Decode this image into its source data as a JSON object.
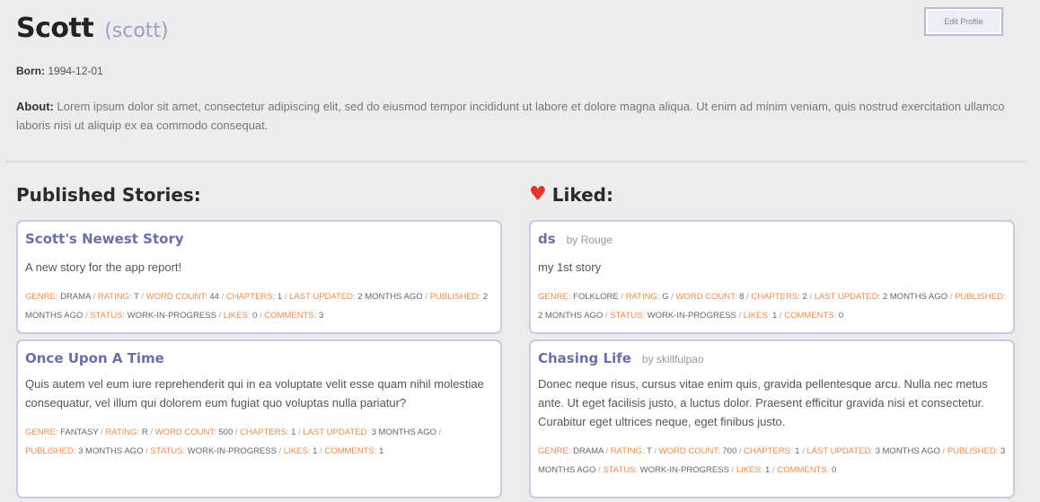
{
  "profile": {
    "name": "Scott",
    "username": "(scott)",
    "edit_button": "Edit Profile",
    "born_label": "Born:",
    "born_value": "1994-12-01",
    "about_label": "About:",
    "about_text": "Lorem ipsum dolor sit amet, consectetur adipiscing elit, sed do eiusmod tempor incididunt ut labore et dolore magna aliqua. Ut enim ad minim veniam, quis nostrud exercitation ullamco laboris nisi ut aliquip ex ea commodo consequat."
  },
  "published": {
    "title": "Published Stories:",
    "stories": [
      {
        "title": "Scott's Newest Story",
        "description": "A new story for the app report!",
        "genre": "DRAMA",
        "rating": "T",
        "word_count": "44",
        "chapters": "1",
        "last_updated": "2 MONTHS AGO",
        "published": "2 MONTHS AGO",
        "status": "WORK-IN-PROGRESS",
        "likes": "0",
        "comments": "3"
      },
      {
        "title": "Once Upon A Time",
        "description": "Quis autem vel eum iure reprehenderit qui in ea voluptate velit esse quam nihil molestiae consequatur, vel illum qui dolorem eum fugiat quo voluptas nulla pariatur?",
        "genre": "FANTASY",
        "rating": "R",
        "word_count": "500",
        "chapters": "1",
        "last_updated": "3 MONTHS AGO",
        "published": "3 MONTHS AGO",
        "status": "WORK-IN-PROGRESS",
        "likes": "1",
        "comments": "1"
      }
    ]
  },
  "liked": {
    "title": "Liked:",
    "heart_icon": "heart-icon",
    "stories": [
      {
        "title": "ds",
        "author": "by Rouge",
        "description": "my 1st story",
        "genre": "FOLKLORE",
        "rating": "G",
        "word_count": "8",
        "chapters": "2",
        "last_updated": "2 MONTHS AGO",
        "published": "2 MONTHS AGO",
        "status": "WORK-IN-PROGRESS",
        "likes": "1",
        "comments": "0"
      },
      {
        "title": "Chasing Life",
        "author": "by skillfulpao",
        "description": "Donec neque risus, cursus vitae enim quis, gravida pellentesque arcu. Nulla nec metus ante. Ut eget facilisis justo, a luctus dolor. Praesent efficitur gravida nisi et consectetur. Curabitur eget ultrices neque, eget finibus justo.",
        "genre": "DRAMA",
        "rating": "T",
        "word_count": "700",
        "chapters": "1",
        "last_updated": "3 MONTHS AGO",
        "published": "3 MONTHS AGO",
        "status": "WORK-IN-PROGRESS",
        "likes": "1",
        "comments": "0"
      }
    ]
  },
  "meta_labels": {
    "genre": "GENRE:",
    "rating": "RATING:",
    "word_count": "WORD COUNT:",
    "chapters": "CHAPTERS:",
    "last_updated": "LAST UPDATED:",
    "published": "PUBLISHED:",
    "status": "STATUS:",
    "likes": "LIKES:",
    "comments": "COMMENTS:",
    "separator": "/"
  },
  "colors": {
    "accent": "#6b6fa8",
    "meta_key": "#ef8a4a",
    "heart": "#e0392b"
  }
}
